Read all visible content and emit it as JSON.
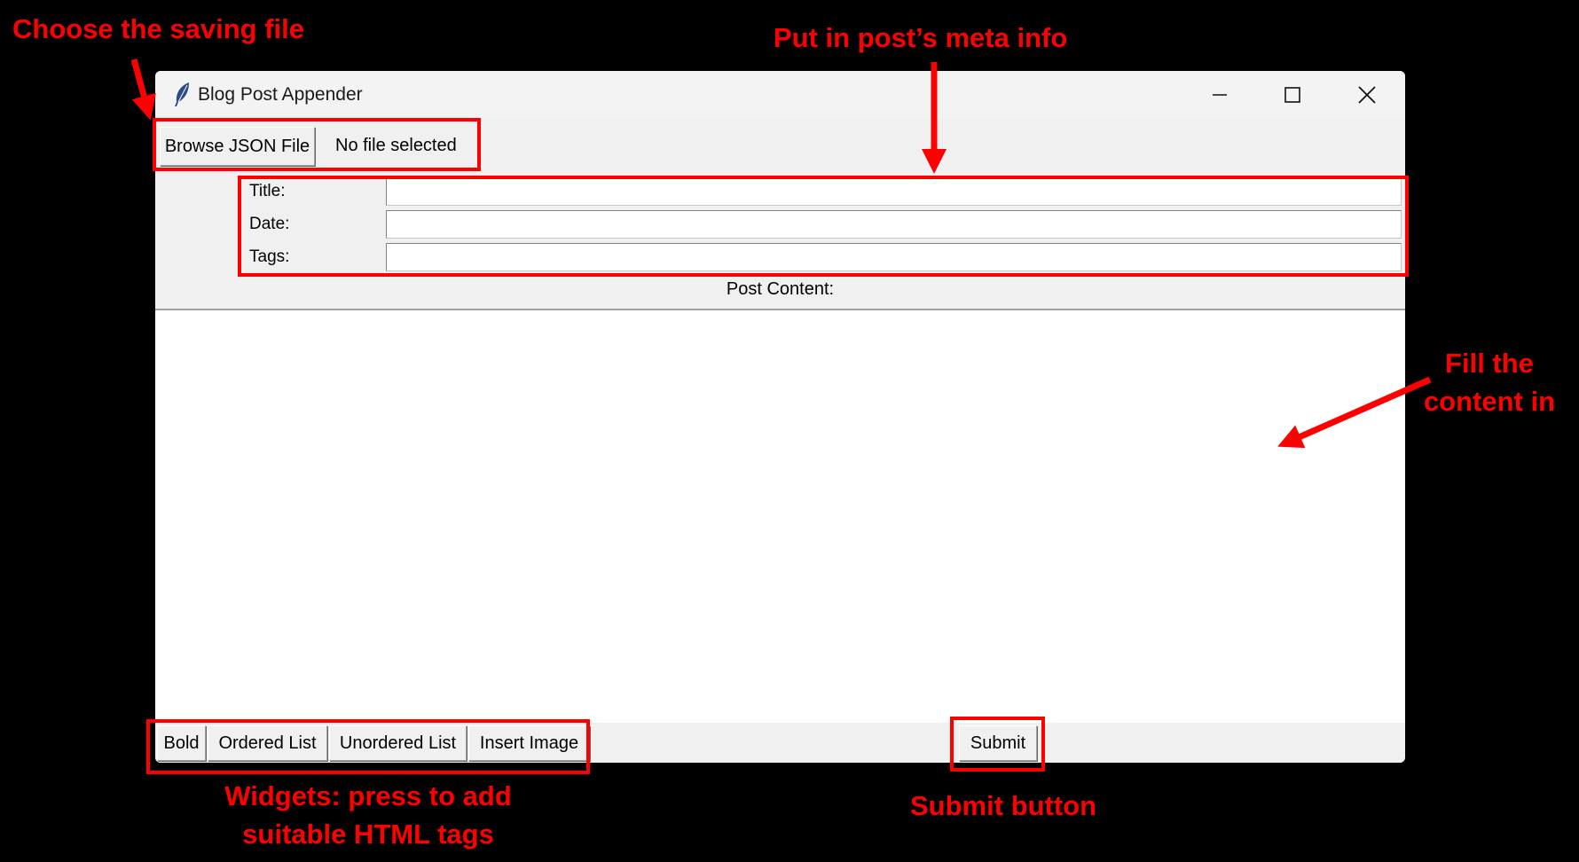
{
  "window": {
    "title": "Blog Post Appender",
    "minimize_icon": "minimize-icon",
    "maximize_icon": "maximize-icon",
    "close_icon": "close-icon",
    "app_icon": "feather-icon"
  },
  "file_row": {
    "browse_label": "Browse JSON File",
    "file_status": "No file selected"
  },
  "form": {
    "title_label": "Title:",
    "date_label": "Date:",
    "tags_label": "Tags:",
    "title_value": "",
    "date_value": "",
    "tags_value": ""
  },
  "content": {
    "label": "Post Content:",
    "value": ""
  },
  "toolbar": {
    "bold_label": "Bold",
    "ordered_label": "Ordered List",
    "unordered_label": "Unordered List",
    "image_label": "Insert Image",
    "submit_label": "Submit"
  },
  "annotations": {
    "choose_file": "Choose the saving file",
    "meta_info": "Put in post’s meta info",
    "fill_content_1": "Fill the",
    "fill_content_2": "content in",
    "widgets_1": "Widgets: press to add",
    "widgets_2": "suitable HTML tags",
    "submit": "Submit button",
    "color": "#ff0000"
  }
}
